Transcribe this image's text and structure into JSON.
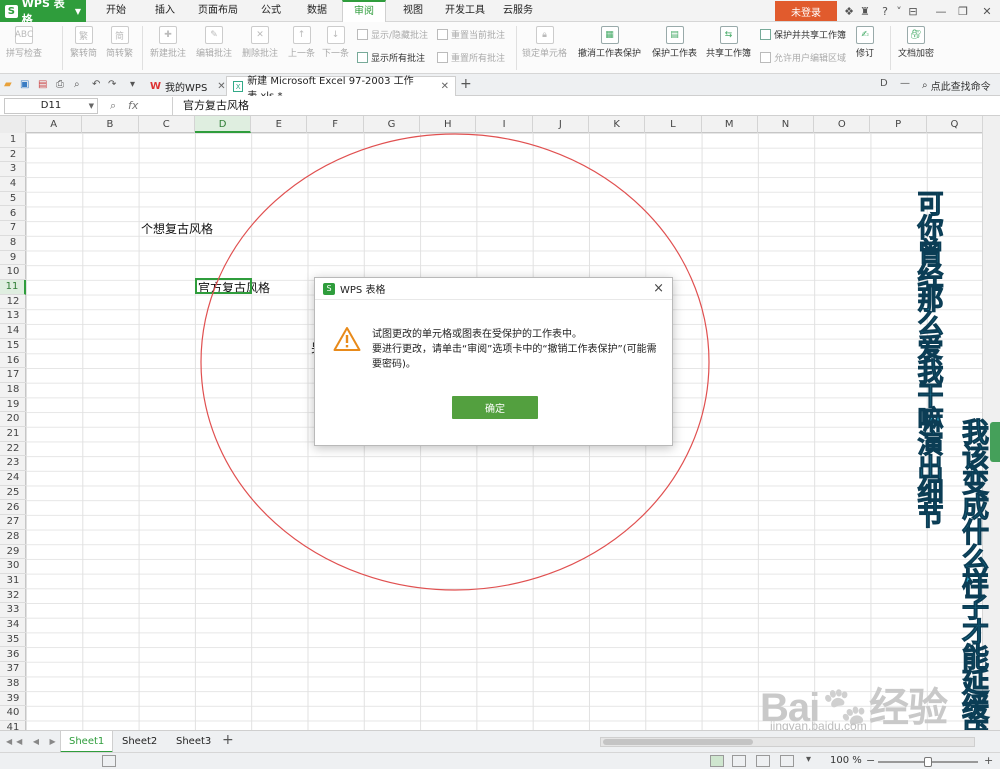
{
  "app": {
    "name": "WPS 表格"
  },
  "menu": {
    "tabs": [
      "开始",
      "插入",
      "页面布局",
      "公式",
      "数据",
      "审阅",
      "视图",
      "开发工具",
      "云服务"
    ],
    "active_tab": "审阅",
    "login": "未登录"
  },
  "ribbon": {
    "spell_check": "拼写检查",
    "to_traditional": "繁转简",
    "to_simplified": "简转繁",
    "new_comment": "新建批注",
    "edit_comment": "编辑批注",
    "delete_comment": "删除批注",
    "prev": "上一条",
    "next": "下一条",
    "show_hide_comment": "显示/隐藏批注",
    "reset_current_comment": "重置当前批注",
    "show_all_comments": "显示所有批注",
    "reset_all_comments": "重置所有批注",
    "lock_cell": "锁定单元格",
    "unprotect_sheet": "撤消工作表保护",
    "protect_sheet": "保护工作表",
    "share_workbook": "共享工作簿",
    "protect_and_share": "保护并共享工作簿",
    "allow_edit_ranges": "允许用户编辑区域",
    "track_changes": "修订",
    "encrypt_document": "文档加密"
  },
  "doctabs": {
    "my_wps": "我的WPS",
    "file_name": "新建 Microsoft Excel 97-2003 工作表.xls *",
    "find_command": "点此查找命令"
  },
  "formula_bar": {
    "name_box": "D11",
    "fx": "fx",
    "content": "官方复古风格"
  },
  "grid": {
    "columns": [
      "A",
      "B",
      "C",
      "D",
      "E",
      "F",
      "G",
      "H",
      "I",
      "J",
      "K",
      "L",
      "M",
      "N",
      "O",
      "P",
      "Q"
    ],
    "selected_column": "D",
    "row_count": 41,
    "selected_row": 11,
    "cells": {
      "C7": "个想复古风格",
      "D11": "官方复古风格",
      "F15": "另"
    }
  },
  "overlay": {
    "vertical_text_1": "可你曾经那么爱我干嘛演出细节",
    "vertical_text_2": "我该变成什么样子才能延缓厌倦",
    "circle_color": "#e05050"
  },
  "dialog": {
    "title": "WPS 表格",
    "line1": "试图更改的单元格或图表在受保护的工作表中。",
    "line2": "要进行更改，请单击“审阅”选项卡中的“撤销工作表保护”(可能需要密码)。",
    "ok": "确定",
    "close": "×"
  },
  "sheets": {
    "tabs": [
      "Sheet1",
      "Sheet2",
      "Sheet3"
    ],
    "active": "Sheet1"
  },
  "status": {
    "zoom": "100 %",
    "zoom_level": 0.5
  },
  "watermark": {
    "brand": "Bai",
    "brand_cn": "经验",
    "url": "jingyan.baidu.com"
  },
  "colors": {
    "accent": "#2f9d3c",
    "login": "#e15b2d",
    "dialog_ok": "#53a03f",
    "overlay_text": "#29a7c9"
  }
}
